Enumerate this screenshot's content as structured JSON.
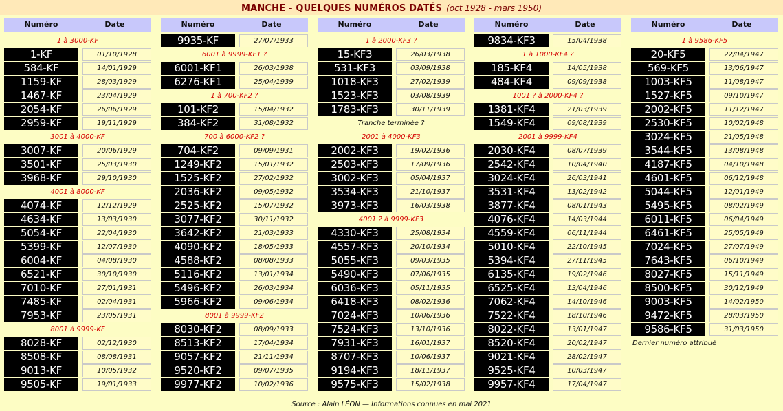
{
  "title": {
    "main": "MANCHE - QUELQUES NUMÉROS DATÉS",
    "sub": "(oct 1928 - mars 1950)"
  },
  "header": {
    "numero": "Numéro",
    "date": "Date"
  },
  "columns": [
    {
      "items": [
        {
          "type": "sec",
          "text": "1 à 3000-KF"
        },
        {
          "type": "row",
          "plate": "1-KF",
          "date": "01/10/1928"
        },
        {
          "type": "row",
          "plate": "584-KF",
          "date": "14/01/1929"
        },
        {
          "type": "row",
          "plate": "1159-KF",
          "date": "28/03/1929"
        },
        {
          "type": "row",
          "plate": "1467-KF",
          "date": "23/04/1929"
        },
        {
          "type": "row",
          "plate": "2054-KF",
          "date": "26/06/1929"
        },
        {
          "type": "row",
          "plate": "2959-KF",
          "date": "19/11/1929"
        },
        {
          "type": "sec",
          "text": "3001 à 4000-KF"
        },
        {
          "type": "row",
          "plate": "3007-KF",
          "date": "20/06/1929"
        },
        {
          "type": "row",
          "plate": "3501-KF",
          "date": "25/03/1930"
        },
        {
          "type": "row",
          "plate": "3968-KF",
          "date": "29/10/1930"
        },
        {
          "type": "sec",
          "text": "4001 à 8000-KF"
        },
        {
          "type": "row",
          "plate": "4074-KF",
          "date": "12/12/1929"
        },
        {
          "type": "row",
          "plate": "4634-KF",
          "date": "13/03/1930"
        },
        {
          "type": "row",
          "plate": "5054-KF",
          "date": "22/04/1930"
        },
        {
          "type": "row",
          "plate": "5399-KF",
          "date": "12/07/1930"
        },
        {
          "type": "row",
          "plate": "6004-KF",
          "date": "04/08/1930"
        },
        {
          "type": "row",
          "plate": "6521-KF",
          "date": "30/10/1930"
        },
        {
          "type": "row",
          "plate": "7010-KF",
          "date": "27/01/1931"
        },
        {
          "type": "row",
          "plate": "7485-KF",
          "date": "02/04/1931"
        },
        {
          "type": "row",
          "plate": "7953-KF",
          "date": "23/05/1931"
        },
        {
          "type": "sec",
          "text": "8001 à 9999-KF"
        },
        {
          "type": "row",
          "plate": "8028-KF",
          "date": "02/12/1930"
        },
        {
          "type": "row",
          "plate": "8508-KF",
          "date": "08/08/1931"
        },
        {
          "type": "row",
          "plate": "9013-KF",
          "date": "10/05/1932"
        },
        {
          "type": "row",
          "plate": "9505-KF",
          "date": "19/01/1933"
        }
      ]
    },
    {
      "items": [
        {
          "type": "row",
          "plate": "9935-KF",
          "date": "27/07/1933"
        },
        {
          "type": "sec",
          "text": "6001 à 9999-KF1 ?"
        },
        {
          "type": "row",
          "plate": "6001-KF1",
          "date": "26/03/1938"
        },
        {
          "type": "row",
          "plate": "6276-KF1",
          "date": "25/04/1939"
        },
        {
          "type": "sec",
          "text": "1 à 700-KF2 ?"
        },
        {
          "type": "row",
          "plate": "101-KF2",
          "date": "15/04/1932"
        },
        {
          "type": "row",
          "plate": "384-KF2",
          "date": "31/08/1932"
        },
        {
          "type": "sec",
          "text": "700 à 6000-KF2 ?"
        },
        {
          "type": "row",
          "plate": "704-KF2",
          "date": "09/09/1931"
        },
        {
          "type": "row",
          "plate": "1249-KF2",
          "date": "15/01/1932"
        },
        {
          "type": "row",
          "plate": "1525-KF2",
          "date": "27/02/1932"
        },
        {
          "type": "row",
          "plate": "2036-KF2",
          "date": "09/05/1932"
        },
        {
          "type": "row",
          "plate": "2525-KF2",
          "date": "15/07/1932"
        },
        {
          "type": "row",
          "plate": "3077-KF2",
          "date": "30/11/1932"
        },
        {
          "type": "row",
          "plate": "3642-KF2",
          "date": "21/03/1933"
        },
        {
          "type": "row",
          "plate": "4090-KF2",
          "date": "18/05/1933"
        },
        {
          "type": "row",
          "plate": "4588-KF2",
          "date": "08/08/1933"
        },
        {
          "type": "row",
          "plate": "5116-KF2",
          "date": "13/01/1934"
        },
        {
          "type": "row",
          "plate": "5496-KF2",
          "date": "26/03/1934"
        },
        {
          "type": "row",
          "plate": "5966-KF2",
          "date": "09/06/1934"
        },
        {
          "type": "sec",
          "text": "8001 à 9999-KF2"
        },
        {
          "type": "row",
          "plate": "8030-KF2",
          "date": "08/09/1933"
        },
        {
          "type": "row",
          "plate": "8513-KF2",
          "date": "17/04/1934"
        },
        {
          "type": "row",
          "plate": "9057-KF2",
          "date": "21/11/1934"
        },
        {
          "type": "row",
          "plate": "9520-KF2",
          "date": "09/07/1935"
        },
        {
          "type": "row",
          "plate": "9977-KF2",
          "date": "10/02/1936"
        }
      ]
    },
    {
      "items": [
        {
          "type": "sec",
          "text": "1 à 2000-KF3 ?"
        },
        {
          "type": "row",
          "plate": "15-KF3",
          "date": "26/03/1938"
        },
        {
          "type": "row",
          "plate": "531-KF3",
          "date": "03/09/1938"
        },
        {
          "type": "row",
          "plate": "1018-KF3",
          "date": "27/02/1939"
        },
        {
          "type": "row",
          "plate": "1523-KF3",
          "date": "03/08/1939"
        },
        {
          "type": "row",
          "plate": "1783-KF3",
          "date": "30/11/1939"
        },
        {
          "type": "note",
          "text": "Tranche terminée ?"
        },
        {
          "type": "sec",
          "text": "2001 à 4000-KF3"
        },
        {
          "type": "row",
          "plate": "2002-KF3",
          "date": "19/02/1936"
        },
        {
          "type": "row",
          "plate": "2503-KF3",
          "date": "17/09/1936"
        },
        {
          "type": "row",
          "plate": "3002-KF3",
          "date": "05/04/1937"
        },
        {
          "type": "row",
          "plate": "3534-KF3",
          "date": "21/10/1937"
        },
        {
          "type": "row",
          "plate": "3973-KF3",
          "date": "16/03/1938"
        },
        {
          "type": "sec",
          "text": "4001 ? à 9999-KF3"
        },
        {
          "type": "row",
          "plate": "4330-KF3",
          "date": "25/08/1934"
        },
        {
          "type": "row",
          "plate": "4557-KF3",
          "date": "20/10/1934"
        },
        {
          "type": "row",
          "plate": "5055-KF3",
          "date": "09/03/1935"
        },
        {
          "type": "row",
          "plate": "5490-KF3",
          "date": "07/06/1935"
        },
        {
          "type": "row",
          "plate": "6036-KF3",
          "date": "05/11/1935"
        },
        {
          "type": "row",
          "plate": "6418-KF3",
          "date": "08/02/1936"
        },
        {
          "type": "row",
          "plate": "7024-KF3",
          "date": "10/06/1936"
        },
        {
          "type": "row",
          "plate": "7524-KF3",
          "date": "13/10/1936"
        },
        {
          "type": "row",
          "plate": "7931-KF3",
          "date": "16/01/1937"
        },
        {
          "type": "row",
          "plate": "8707-KF3",
          "date": "10/06/1937"
        },
        {
          "type": "row",
          "plate": "9194-KF3",
          "date": "18/11/1937"
        },
        {
          "type": "row",
          "plate": "9575-KF3",
          "date": "15/02/1938"
        }
      ]
    },
    {
      "items": [
        {
          "type": "row",
          "plate": "9834-KF3",
          "date": "15/04/1938"
        },
        {
          "type": "sec",
          "text": "1 à 1000-KF4 ?"
        },
        {
          "type": "row",
          "plate": "185-KF4",
          "date": "14/05/1938"
        },
        {
          "type": "row",
          "plate": "484-KF4",
          "date": "09/09/1938"
        },
        {
          "type": "sec",
          "text": "1001 ? à 2000-KF4 ?"
        },
        {
          "type": "row",
          "plate": "1381-KF4",
          "date": "21/03/1939"
        },
        {
          "type": "row",
          "plate": "1549-KF4",
          "date": "09/08/1939"
        },
        {
          "type": "sec",
          "text": "2001 à 9999-KF4"
        },
        {
          "type": "row",
          "plate": "2030-KF4",
          "date": "08/07/1939"
        },
        {
          "type": "row",
          "plate": "2542-KF4",
          "date": "10/04/1940"
        },
        {
          "type": "row",
          "plate": "3024-KF4",
          "date": "26/03/1941"
        },
        {
          "type": "row",
          "plate": "3531-KF4",
          "date": "13/02/1942"
        },
        {
          "type": "row",
          "plate": "3877-KF4",
          "date": "08/01/1943"
        },
        {
          "type": "row",
          "plate": "4076-KF4",
          "date": "14/03/1944"
        },
        {
          "type": "row",
          "plate": "4559-KF4",
          "date": "06/11/1944"
        },
        {
          "type": "row",
          "plate": "5010-KF4",
          "date": "22/10/1945"
        },
        {
          "type": "row",
          "plate": "5394-KF4",
          "date": "27/11/1945"
        },
        {
          "type": "row",
          "plate": "6135-KF4",
          "date": "19/02/1946"
        },
        {
          "type": "row",
          "plate": "6525-KF4",
          "date": "13/04/1946"
        },
        {
          "type": "row",
          "plate": "7062-KF4",
          "date": "14/10/1946"
        },
        {
          "type": "row",
          "plate": "7522-KF4",
          "date": "18/10/1946"
        },
        {
          "type": "row",
          "plate": "8022-KF4",
          "date": "13/01/1947"
        },
        {
          "type": "row",
          "plate": "8520-KF4",
          "date": "20/02/1947"
        },
        {
          "type": "row",
          "plate": "9021-KF4",
          "date": "28/02/1947"
        },
        {
          "type": "row",
          "plate": "9525-KF4",
          "date": "10/03/1947"
        },
        {
          "type": "row",
          "plate": "9957-KF4",
          "date": "17/04/1947"
        }
      ]
    },
    {
      "items": [
        {
          "type": "sec",
          "text": "1 à 9586-KF5"
        },
        {
          "type": "row",
          "plate": "20-KF5",
          "date": "22/04/1947"
        },
        {
          "type": "row",
          "plate": "569-KF5",
          "date": "13/06/1947"
        },
        {
          "type": "row",
          "plate": "1003-KF5",
          "date": "11/08/1947"
        },
        {
          "type": "row",
          "plate": "1527-KF5",
          "date": "09/10/1947"
        },
        {
          "type": "row",
          "plate": "2002-KF5",
          "date": "11/12/1947"
        },
        {
          "type": "row",
          "plate": "2530-KF5",
          "date": "10/02/1948"
        },
        {
          "type": "row",
          "plate": "3024-KF5",
          "date": "21/05/1948"
        },
        {
          "type": "row",
          "plate": "3544-KF5",
          "date": "13/08/1948"
        },
        {
          "type": "row",
          "plate": "4187-KF5",
          "date": "04/10/1948"
        },
        {
          "type": "row",
          "plate": "4601-KF5",
          "date": "06/12/1948"
        },
        {
          "type": "row",
          "plate": "5044-KF5",
          "date": "12/01/1949"
        },
        {
          "type": "row",
          "plate": "5495-KF5",
          "date": "08/02/1949"
        },
        {
          "type": "row",
          "plate": "6011-KF5",
          "date": "06/04/1949"
        },
        {
          "type": "row",
          "plate": "6461-KF5",
          "date": "25/05/1949"
        },
        {
          "type": "row",
          "plate": "7024-KF5",
          "date": "27/07/1949"
        },
        {
          "type": "row",
          "plate": "7643-KF5",
          "date": "06/10/1949"
        },
        {
          "type": "row",
          "plate": "8027-KF5",
          "date": "15/11/1949"
        },
        {
          "type": "row",
          "plate": "8500-KF5",
          "date": "30/12/1949"
        },
        {
          "type": "row",
          "plate": "9003-KF5",
          "date": "14/02/1950"
        },
        {
          "type": "row",
          "plate": "9472-KF5",
          "date": "28/03/1950"
        },
        {
          "type": "row",
          "plate": "9586-KF5",
          "date": "31/03/1950"
        },
        {
          "type": "note-left",
          "text": "Dernier numéro attribué"
        }
      ]
    }
  ],
  "footer": "Source : Alain LÉON — Informations connues en mai 2021"
}
